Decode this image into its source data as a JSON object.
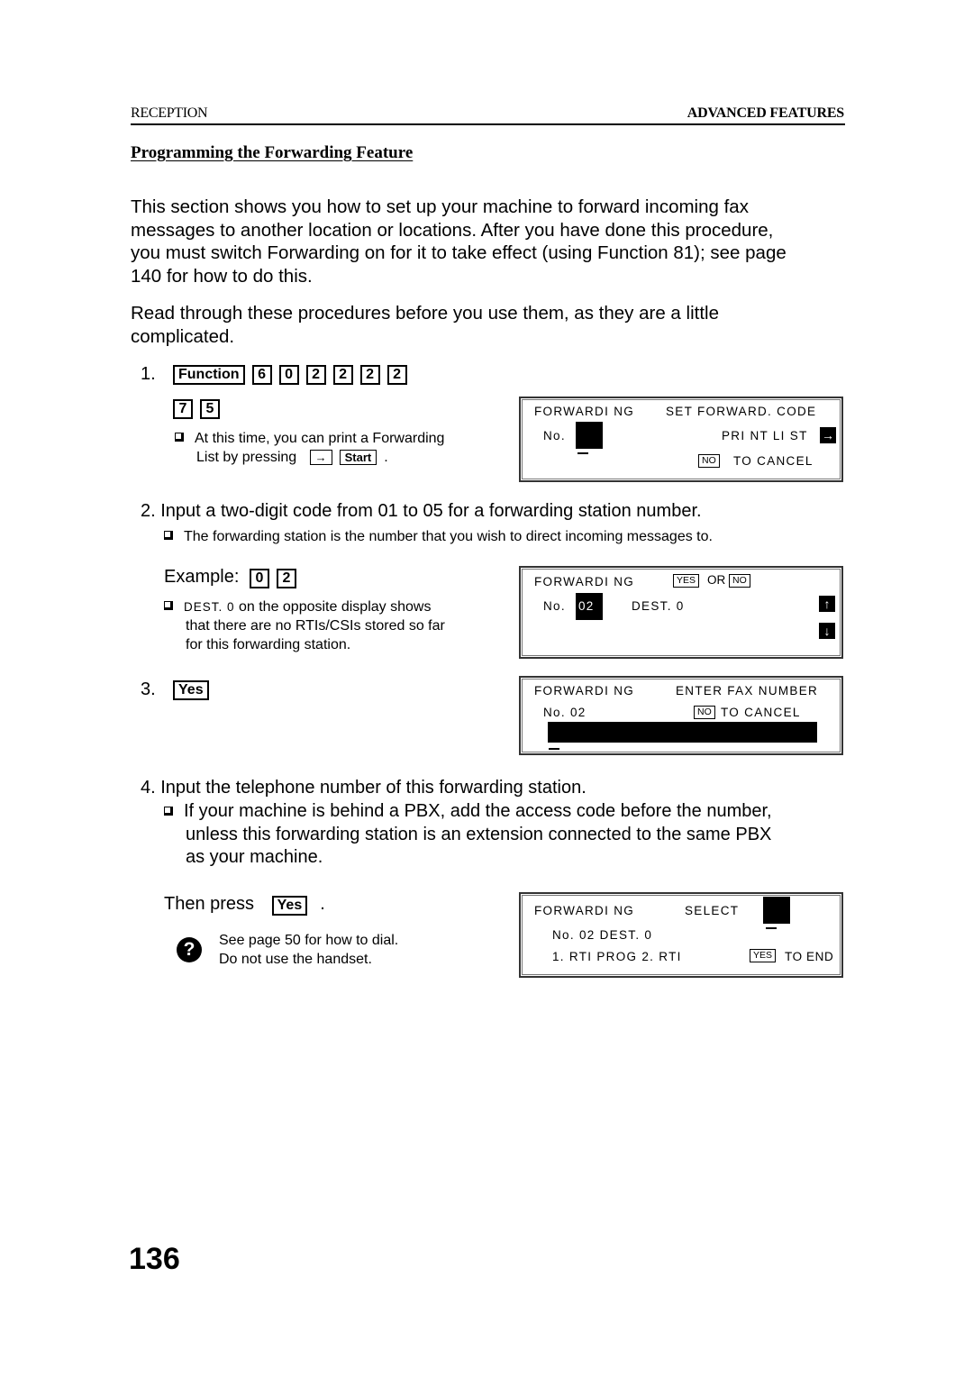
{
  "header": {
    "section_left": "RECEPTION",
    "section_right": "ADVANCED FEATURES"
  },
  "title": "Programming the Forwarding Feature",
  "intro": {
    "paragraph1_lines": [
      "This section shows you how to set up your machine to forward incoming fax",
      "messages to another location or locations. After you have done this procedure,",
      "you must switch Forwarding on for it to take effect (using Function 81); see page",
      "140 for how to do this."
    ],
    "paragraph2_lines": [
      "Read through these procedures before you use them, as they are a little",
      "complicated."
    ]
  },
  "step1": {
    "number": "1.",
    "keys_row1": [
      "Function",
      "6",
      "0",
      "2",
      "2",
      "2",
      "2"
    ],
    "keys_row2": [
      "7",
      "5"
    ],
    "note_line1": "At this time, you can print a Forwarding",
    "note_line2_prefix": "List by pressing",
    "note_keys": [
      "→",
      "Start"
    ],
    "note_suffix": ".",
    "display": {
      "row1_left": "FORWARDI NG",
      "row1_right": "SET FORWARD. CODE",
      "row2_left": "No.",
      "row2_right": "PRI NT LI ST",
      "row2_icon": "→",
      "row3_key": "NO",
      "row3_text": "TO CANCEL"
    }
  },
  "step2": {
    "text": "2. Input a two-digit code from 01 to 05 for a forwarding station number.",
    "note": "The forwarding station is the number that you wish to direct incoming messages to.",
    "example_label": "Example:",
    "example_keys": [
      "0",
      "2"
    ],
    "example_note_code": "DEST. 0",
    "example_note_lines": [
      " on the opposite display shows",
      "that there are no RTIs/CSIs stored so far",
      "for this forwarding station."
    ],
    "display": {
      "row1_left": "FORWARDI NG",
      "yes_key": "YES",
      "or_text": "OR",
      "no_key": "NO",
      "row2_left": "No.",
      "row2_value": "02",
      "row2_right": "DEST. 0",
      "up_icon": "↑",
      "down_icon": "↓"
    }
  },
  "step3": {
    "number": "3.",
    "key": "Yes",
    "display": {
      "row1_left": "FORWARDI NG",
      "row1_right": "ENTER FAX NUMBER",
      "row2_left": "No.  02",
      "row2_key": "NO",
      "row2_text": "TO CANCEL"
    }
  },
  "step4": {
    "text": "4. Input the telephone number of this forwarding station.",
    "note_lines": [
      "If your machine is behind a PBX, add the access code before the number,",
      "unless this forwarding station is an extension connected to the same PBX",
      "as your machine."
    ],
    "then_press": "Then press",
    "key": "Yes",
    "suffix": ".",
    "help_icon": "?",
    "help_lines": [
      "See page 50 for how to dial.",
      "Do not use the handset."
    ],
    "display": {
      "row1_left": "FORWARDI NG",
      "row1_right": "SELECT",
      "row2": "No. 02  DEST. 0",
      "row3": "1. RTI  PROG 2. RTI",
      "row3_key": "YES",
      "row3_text": "TO END"
    }
  },
  "page_number": "136"
}
